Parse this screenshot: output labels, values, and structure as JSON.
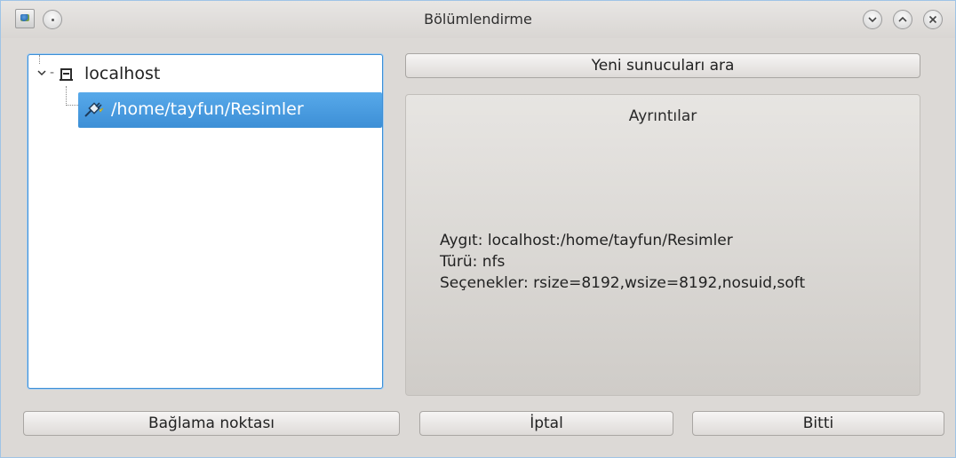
{
  "window": {
    "title": "Bölümlendirme"
  },
  "tree": {
    "root": {
      "label": "localhost",
      "icon": "computer-icon",
      "expanded": true
    },
    "children": [
      {
        "label": "/home/tayfun/Resimler",
        "icon": "network-share-icon",
        "selected": true
      }
    ]
  },
  "buttons": {
    "search_new_servers": "Yeni sunucuları ara",
    "mount_point": "Bağlama noktası",
    "cancel": "İptal",
    "done": "Bitti"
  },
  "details": {
    "title": "Ayrıntılar",
    "device": "Aygıt: localhost:/home/tayfun/Resimler",
    "type": "Türü: nfs",
    "options": "Seçenekler: rsize=8192,wsize=8192,nosuid,soft"
  },
  "colors": {
    "selection": "#3d8fd6",
    "focus_border": "#3d8fd6"
  }
}
